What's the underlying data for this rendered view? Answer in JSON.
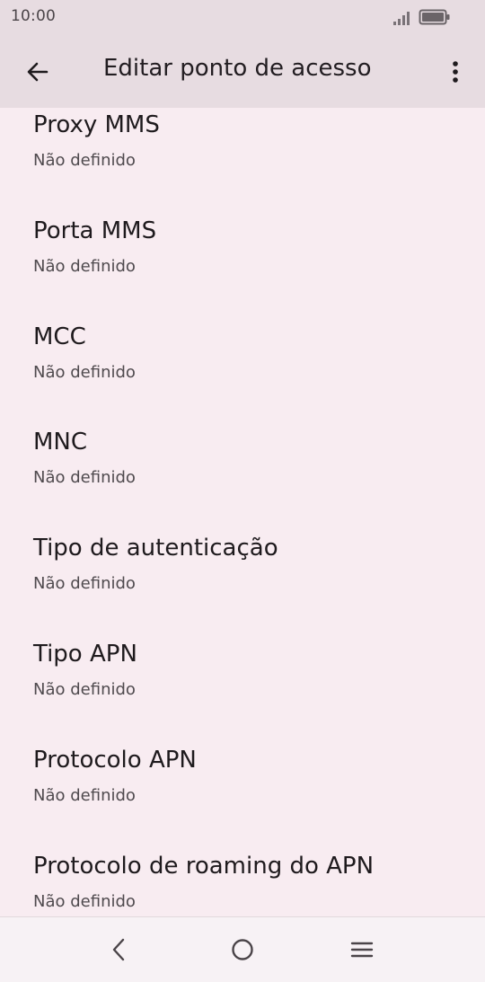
{
  "status_bar": {
    "time": "10:00",
    "icons": [
      "signal-icon",
      "battery-icon"
    ]
  },
  "app_bar": {
    "back_icon": "arrow-back-icon",
    "title": "Editar ponto de acesso",
    "more_icon": "more-vert-icon"
  },
  "items": [
    {
      "title": "Proxy MMS",
      "summary": "Não definido"
    },
    {
      "title": "Porta MMS",
      "summary": "Não definido"
    },
    {
      "title": "MCC",
      "summary": "Não definido"
    },
    {
      "title": "MNC",
      "summary": "Não definido"
    },
    {
      "title": "Tipo de autenticação",
      "summary": "Não definido"
    },
    {
      "title": "Tipo APN",
      "summary": "Não definido"
    },
    {
      "title": "Protocolo APN",
      "summary": "Não definido"
    },
    {
      "title": "Protocolo de roaming do APN",
      "summary": "Não definido"
    }
  ],
  "nav_bar": {
    "icons": [
      "nav-back-icon",
      "nav-home-icon",
      "nav-menu-icon"
    ]
  }
}
